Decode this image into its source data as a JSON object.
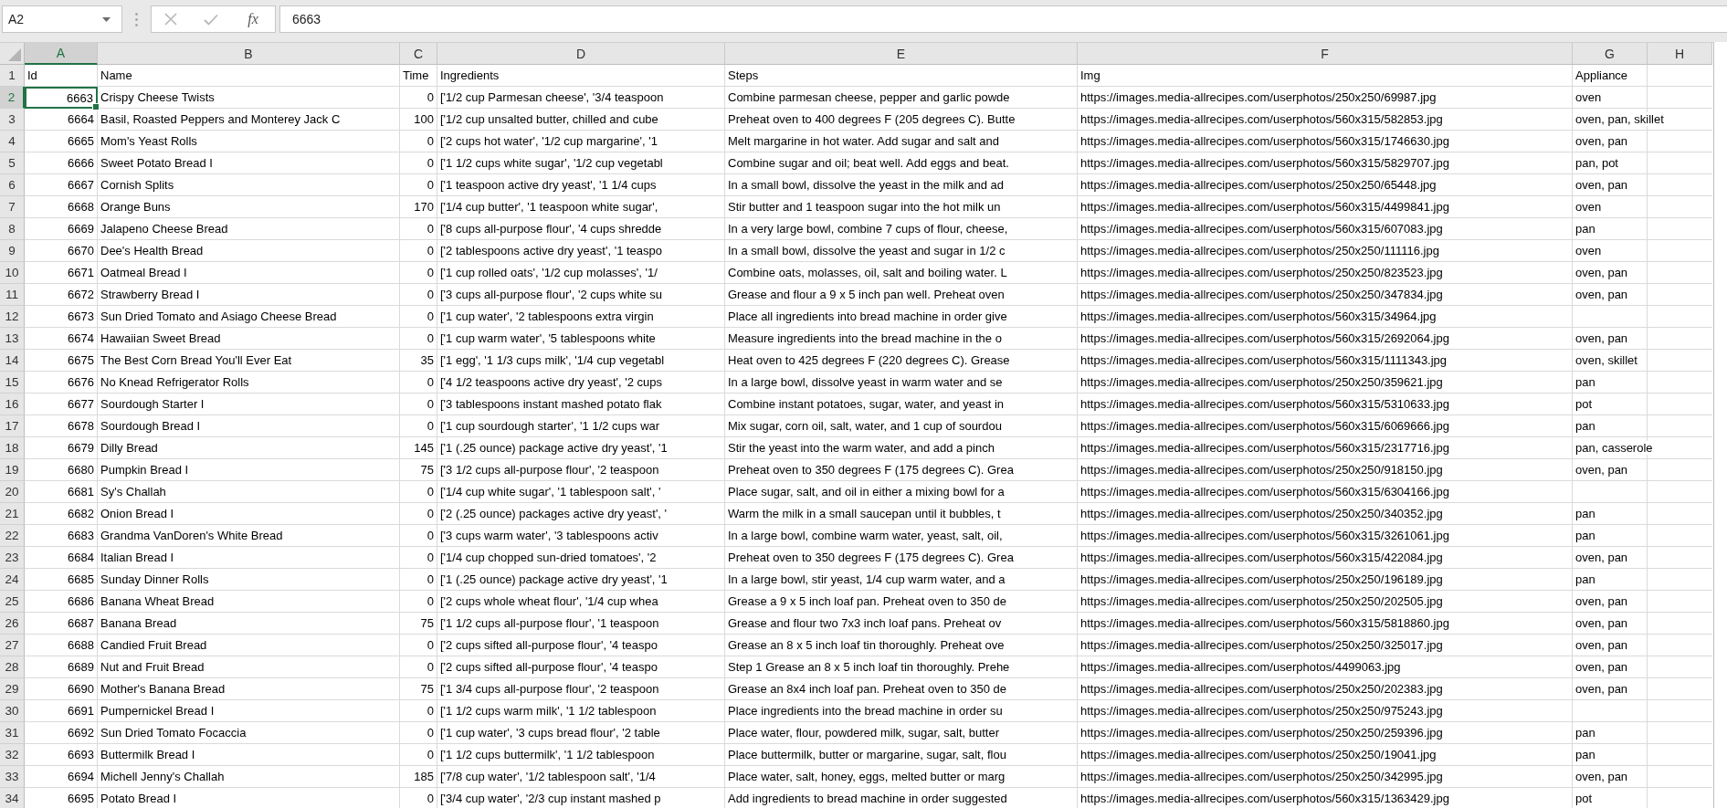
{
  "formula_bar": {
    "name_box": "A2",
    "function_button": "fx",
    "value": "6663"
  },
  "columns": [
    {
      "label": "A",
      "selected": true
    },
    {
      "label": "B",
      "selected": false
    },
    {
      "label": "C",
      "selected": false
    },
    {
      "label": "D",
      "selected": false
    },
    {
      "label": "E",
      "selected": false
    },
    {
      "label": "F",
      "selected": false
    },
    {
      "label": "G",
      "selected": false
    },
    {
      "label": "H",
      "selected": false
    }
  ],
  "rows": [
    {
      "number": "1",
      "kind": "header",
      "selected": false,
      "id": "Id",
      "name": "Name",
      "time": "Time",
      "ingredients": "Ingredients",
      "steps": "Steps",
      "img": "Img",
      "appliance": "Appliance"
    },
    {
      "number": "2",
      "kind": "record",
      "selected": true,
      "id": "6663",
      "name": "Crispy Cheese Twists",
      "time": "0",
      "ingredients": "['1/2 cup Parmesan cheese', '3/4 teaspoon",
      "steps": "Combine parmesan cheese, pepper and garlic powde",
      "img": "https://images.media-allrecipes.com/userphotos/250x250/69987.jpg",
      "appliance": "oven"
    },
    {
      "number": "3",
      "kind": "record",
      "selected": false,
      "id": "6664",
      "name": "Basil, Roasted Peppers and Monterey Jack C",
      "time": "100",
      "ingredients": "['1/2 cup unsalted butter, chilled and cube",
      "steps": "Preheat oven to 400 degrees F (205 degrees C). Butte",
      "img": "https://images.media-allrecipes.com/userphotos/560x315/582853.jpg",
      "appliance": "oven, pan, skillet"
    },
    {
      "number": "4",
      "kind": "record",
      "selected": false,
      "id": "6665",
      "name": "Mom's Yeast Rolls",
      "time": "0",
      "ingredients": "['2 cups hot water', '1/2 cup margarine', '1",
      "steps": "Melt margarine in hot water. Add sugar and salt and",
      "img": "https://images.media-allrecipes.com/userphotos/560x315/1746630.jpg",
      "appliance": "oven, pan"
    },
    {
      "number": "5",
      "kind": "record",
      "selected": false,
      "id": "6666",
      "name": "Sweet Potato Bread I",
      "time": "0",
      "ingredients": "['1 1/2 cups white sugar', '1/2 cup vegetabl",
      "steps": "Combine sugar and oil; beat well. Add eggs and beat.",
      "img": "https://images.media-allrecipes.com/userphotos/560x315/5829707.jpg",
      "appliance": "pan, pot"
    },
    {
      "number": "6",
      "kind": "record",
      "selected": false,
      "id": "6667",
      "name": "Cornish Splits",
      "time": "0",
      "ingredients": "['1 teaspoon active dry yeast', '1 1/4 cups",
      "steps": "In a small bowl, dissolve the yeast in the milk and ad",
      "img": "https://images.media-allrecipes.com/userphotos/250x250/65448.jpg",
      "appliance": "oven, pan"
    },
    {
      "number": "7",
      "kind": "record",
      "selected": false,
      "id": "6668",
      "name": "Orange Buns",
      "time": "170",
      "ingredients": "['1/4 cup butter', '1 teaspoon white sugar',",
      "steps": "Stir butter and 1 teaspoon sugar into the hot milk un",
      "img": "https://images.media-allrecipes.com/userphotos/560x315/4499841.jpg",
      "appliance": "oven"
    },
    {
      "number": "8",
      "kind": "record",
      "selected": false,
      "id": "6669",
      "name": "Jalapeno Cheese Bread",
      "time": "0",
      "ingredients": "['8 cups all-purpose flour', '4 cups shredde",
      "steps": "In a very large bowl, combine 7 cups of flour, cheese,",
      "img": "https://images.media-allrecipes.com/userphotos/560x315/607083.jpg",
      "appliance": "pan"
    },
    {
      "number": "9",
      "kind": "record",
      "selected": false,
      "id": "6670",
      "name": "Dee's Health Bread",
      "time": "0",
      "ingredients": "['2 tablespoons active dry yeast', '1 teaspo",
      "steps": "In a small bowl, dissolve the yeast and sugar in 1/2 c",
      "img": "https://images.media-allrecipes.com/userphotos/250x250/111116.jpg",
      "appliance": "oven"
    },
    {
      "number": "10",
      "kind": "record",
      "selected": false,
      "id": "6671",
      "name": "Oatmeal Bread I",
      "time": "0",
      "ingredients": "['1 cup rolled oats', '1/2 cup molasses', '1/",
      "steps": "Combine oats, molasses, oil, salt and boiling water. L",
      "img": "https://images.media-allrecipes.com/userphotos/250x250/823523.jpg",
      "appliance": "oven, pan"
    },
    {
      "number": "11",
      "kind": "record",
      "selected": false,
      "id": "6672",
      "name": "Strawberry Bread I",
      "time": "0",
      "ingredients": "['3 cups all-purpose flour', '2 cups white su",
      "steps": "Grease and flour a 9 x 5 inch pan well. Preheat oven",
      "img": "https://images.media-allrecipes.com/userphotos/250x250/347834.jpg",
      "appliance": "oven, pan"
    },
    {
      "number": "12",
      "kind": "record",
      "selected": false,
      "id": "6673",
      "name": "Sun Dried Tomato and Asiago Cheese Bread",
      "time": "0",
      "ingredients": "['1 cup water', '2 tablespoons extra virgin",
      "steps": "Place all ingredients into bread machine in order give",
      "img": "https://images.media-allrecipes.com/userphotos/560x315/34964.jpg"
    },
    {
      "number": "13",
      "kind": "record",
      "selected": false,
      "id": "6674",
      "name": "Hawaiian Sweet Bread",
      "time": "0",
      "ingredients": "['1 cup warm water', '5 tablespoons white",
      "steps": "Measure ingredients into the bread machine in the o",
      "img": "https://images.media-allrecipes.com/userphotos/560x315/2692064.jpg",
      "appliance": "oven, pan"
    },
    {
      "number": "14",
      "kind": "record",
      "selected": false,
      "id": "6675",
      "name": "The Best Corn Bread You'll Ever Eat",
      "time": "35",
      "ingredients": "['1 egg', '1 1/3 cups milk', '1/4 cup vegetabl",
      "steps": "Heat oven to 425 degrees F (220 degrees C). Grease",
      "img": "https://images.media-allrecipes.com/userphotos/560x315/1111343.jpg",
      "appliance": "oven, skillet"
    },
    {
      "number": "15",
      "kind": "record",
      "selected": false,
      "id": "6676",
      "name": "No Knead Refrigerator Rolls",
      "time": "0",
      "ingredients": "['4 1/2 teaspoons active dry yeast', '2 cups",
      "steps": "In a large bowl, dissolve yeast in warm water and se",
      "img": "https://images.media-allrecipes.com/userphotos/250x250/359621.jpg",
      "appliance": "pan"
    },
    {
      "number": "16",
      "kind": "record",
      "selected": false,
      "id": "6677",
      "name": "Sourdough Starter I",
      "time": "0",
      "ingredients": "['3 tablespoons instant mashed potato flak",
      "steps": "Combine instant potatoes, sugar, water, and yeast in",
      "img": "https://images.media-allrecipes.com/userphotos/560x315/5310633.jpg",
      "appliance": "pot"
    },
    {
      "number": "17",
      "kind": "record",
      "selected": false,
      "id": "6678",
      "name": "Sourdough Bread I",
      "time": "0",
      "ingredients": "['1 cup sourdough starter', '1 1/2 cups war",
      "steps": "Mix sugar, corn oil, salt, water, and 1 cup of sourdou",
      "img": "https://images.media-allrecipes.com/userphotos/560x315/6069666.jpg",
      "appliance": "pan"
    },
    {
      "number": "18",
      "kind": "record",
      "selected": false,
      "id": "6679",
      "name": "Dilly Bread",
      "time": "145",
      "ingredients": "['1 (.25 ounce) package active dry yeast', '1",
      "steps": "Stir the yeast into the warm water, and add a pinch",
      "img": "https://images.media-allrecipes.com/userphotos/560x315/2317716.jpg",
      "appliance": "pan, casserole"
    },
    {
      "number": "19",
      "kind": "record",
      "selected": false,
      "id": "6680",
      "name": "Pumpkin Bread I",
      "time": "75",
      "ingredients": "['3 1/2 cups all-purpose flour', '2 teaspoon",
      "steps": "Preheat oven to 350 degrees F (175 degrees C). Grea",
      "img": "https://images.media-allrecipes.com/userphotos/250x250/918150.jpg",
      "appliance": "oven, pan"
    },
    {
      "number": "20",
      "kind": "record",
      "selected": false,
      "id": "6681",
      "name": "Sy's Challah",
      "time": "0",
      "ingredients": "['1/4 cup white sugar', '1 tablespoon salt', '",
      "steps": "Place sugar, salt, and oil in either a mixing bowl for a",
      "img": "https://images.media-allrecipes.com/userphotos/560x315/6304166.jpg"
    },
    {
      "number": "21",
      "kind": "record",
      "selected": false,
      "id": "6682",
      "name": "Onion Bread I",
      "time": "0",
      "ingredients": "['2 (.25 ounce) packages active dry yeast', '",
      "steps": "Warm the milk in a small saucepan until it bubbles, t",
      "img": "https://images.media-allrecipes.com/userphotos/250x250/340352.jpg",
      "appliance": "pan"
    },
    {
      "number": "22",
      "kind": "record",
      "selected": false,
      "id": "6683",
      "name": "Grandma VanDoren's White Bread",
      "time": "0",
      "ingredients": "['3 cups warm water', '3 tablespoons activ",
      "steps": "In a large bowl, combine warm water, yeast, salt, oil,",
      "img": "https://images.media-allrecipes.com/userphotos/560x315/3261061.jpg",
      "appliance": "pan"
    },
    {
      "number": "23",
      "kind": "record",
      "selected": false,
      "id": "6684",
      "name": "Italian Bread I",
      "time": "0",
      "ingredients": "['1/4 cup chopped sun-dried tomatoes', '2",
      "steps": "Preheat oven to 350 degrees F (175 degrees C). Grea",
      "img": "https://images.media-allrecipes.com/userphotos/560x315/422084.jpg",
      "appliance": "oven, pan"
    },
    {
      "number": "24",
      "kind": "record",
      "selected": false,
      "id": "6685",
      "name": "Sunday Dinner Rolls",
      "time": "0",
      "ingredients": "['1 (.25 ounce) package active dry yeast', '1",
      "steps": "In a large bowl, stir yeast, 1/4 cup warm water, and a",
      "img": "https://images.media-allrecipes.com/userphotos/250x250/196189.jpg",
      "appliance": "pan"
    },
    {
      "number": "25",
      "kind": "record",
      "selected": false,
      "id": "6686",
      "name": "Banana Wheat Bread",
      "time": "0",
      "ingredients": "['2 cups whole wheat flour', '1/4 cup whea",
      "steps": "Grease a 9 x 5 inch loaf pan. Preheat oven to 350 de",
      "img": "https://images.media-allrecipes.com/userphotos/250x250/202505.jpg",
      "appliance": "oven, pan"
    },
    {
      "number": "26",
      "kind": "record",
      "selected": false,
      "id": "6687",
      "name": "Banana Bread",
      "time": "75",
      "ingredients": "['1 1/2 cups all-purpose flour', '1 teaspoon",
      "steps": "Grease and flour two 7x3 inch loaf pans. Preheat ov",
      "img": "https://images.media-allrecipes.com/userphotos/560x315/5818860.jpg",
      "appliance": "oven, pan"
    },
    {
      "number": "27",
      "kind": "record",
      "selected": false,
      "id": "6688",
      "name": "Candied Fruit Bread",
      "time": "0",
      "ingredients": "['2 cups sifted all-purpose flour', '4 teaspo",
      "steps": "Grease an 8 x 5 inch loaf tin thoroughly. Preheat ove",
      "img": "https://images.media-allrecipes.com/userphotos/250x250/325017.jpg",
      "appliance": "oven, pan"
    },
    {
      "number": "28",
      "kind": "record",
      "selected": false,
      "id": "6689",
      "name": "Nut and Fruit Bread",
      "time": "0",
      "ingredients": "['2 cups sifted all-purpose flour', '4 teaspo",
      "steps": "Step 1 Grease an 8 x 5 inch loaf tin thoroughly. Prehe",
      "img": "https://images.media-allrecipes.com/userphotos/4499063.jpg",
      "appliance": "oven, pan"
    },
    {
      "number": "29",
      "kind": "record",
      "selected": false,
      "id": "6690",
      "name": "Mother's Banana Bread",
      "time": "75",
      "ingredients": "['1 3/4 cups all-purpose flour', '2 teaspoon",
      "steps": "Grease an 8x4 inch loaf pan. Preheat oven to 350 de",
      "img": "https://images.media-allrecipes.com/userphotos/250x250/202383.jpg",
      "appliance": "oven, pan"
    },
    {
      "number": "30",
      "kind": "record",
      "selected": false,
      "id": "6691",
      "name": "Pumpernickel Bread I",
      "time": "0",
      "ingredients": "['1 1/2 cups warm milk', '1 1/2 tablespoon",
      "steps": "Place ingredients into the bread machine in order su",
      "img": "https://images.media-allrecipes.com/userphotos/250x250/975243.jpg"
    },
    {
      "number": "31",
      "kind": "record",
      "selected": false,
      "id": "6692",
      "name": "Sun Dried Tomato Focaccia",
      "time": "0",
      "ingredients": "['1 cup water', '3 cups bread flour', '2 table",
      "steps": "Place water, flour, powdered milk, sugar, salt, butter",
      "img": "https://images.media-allrecipes.com/userphotos/250x250/259396.jpg",
      "appliance": "pan"
    },
    {
      "number": "32",
      "kind": "record",
      "selected": false,
      "id": "6693",
      "name": "Buttermilk Bread I",
      "time": "0",
      "ingredients": "['1 1/2 cups buttermilk', '1 1/2 tablespoon",
      "steps": "Place buttermilk, butter or margarine, sugar, salt, flou",
      "img": "https://images.media-allrecipes.com/userphotos/250x250/19041.jpg",
      "appliance": "pan"
    },
    {
      "number": "33",
      "kind": "record",
      "selected": false,
      "id": "6694",
      "name": "Michell Jenny's Challah",
      "time": "185",
      "ingredients": "['7/8 cup water', '1/2 tablespoon salt', '1/4",
      "steps": "Place water, salt, honey, eggs, melted butter or marg",
      "img": "https://images.media-allrecipes.com/userphotos/250x250/342995.jpg",
      "appliance": "oven, pan"
    },
    {
      "number": "34",
      "kind": "record",
      "selected": false,
      "id": "6695",
      "name": "Potato Bread I",
      "time": "0",
      "ingredients": "['3/4 cup water', '2/3 cup instant mashed p",
      "steps": "Add ingredients to bread machine in order suggested",
      "img": "https://images.media-allrecipes.com/userphotos/560x315/1363429.jpg",
      "appliance": "pot"
    }
  ]
}
